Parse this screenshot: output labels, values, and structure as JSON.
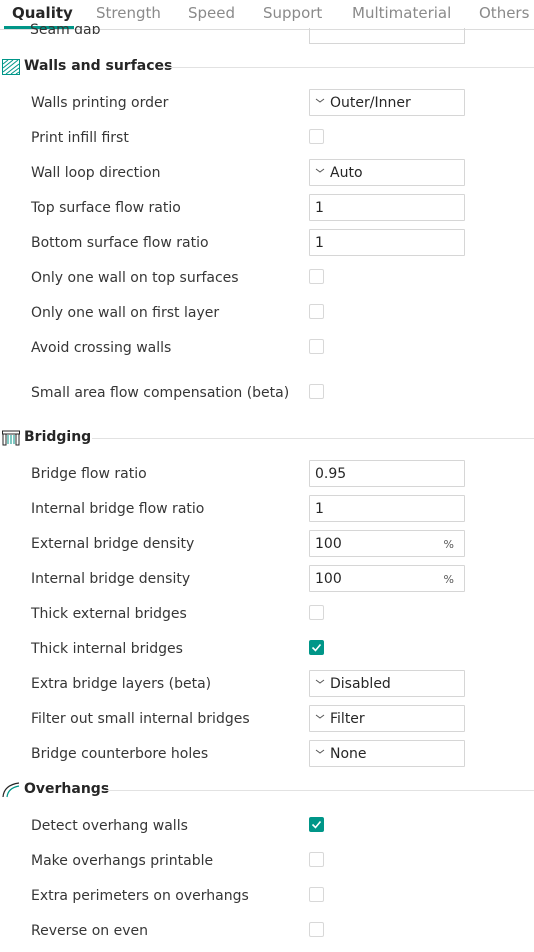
{
  "tabs": [
    {
      "label": "Quality",
      "active": true
    },
    {
      "label": "Strength",
      "active": false
    },
    {
      "label": "Speed",
      "active": false
    },
    {
      "label": "Support",
      "active": false
    },
    {
      "label": "Multimaterial",
      "active": false
    },
    {
      "label": "Others",
      "active": false
    }
  ],
  "partial_row": {
    "label": "Seam gap"
  },
  "sections": {
    "walls": {
      "title": "Walls and surfaces",
      "icon": "walls-surfaces-icon",
      "rows": [
        {
          "label": "Walls printing order",
          "type": "combo",
          "value": "Outer/Inner"
        },
        {
          "label": "Print infill first",
          "type": "checkbox",
          "checked": false
        },
        {
          "label": "Wall loop direction",
          "type": "combo",
          "value": "Auto"
        },
        {
          "label": "Top surface flow ratio",
          "type": "text",
          "value": "1"
        },
        {
          "label": "Bottom surface flow ratio",
          "type": "text",
          "value": "1"
        },
        {
          "label": "Only one wall on top surfaces",
          "type": "checkbox",
          "checked": false
        },
        {
          "label": "Only one wall on first layer",
          "type": "checkbox",
          "checked": false
        },
        {
          "label": "Avoid crossing walls",
          "type": "checkbox",
          "checked": false
        },
        {
          "label": "Small area flow compensation (beta)",
          "type": "checkbox",
          "checked": false
        }
      ]
    },
    "bridging": {
      "title": "Bridging",
      "icon": "bridging-icon",
      "rows": [
        {
          "label": "Bridge flow ratio",
          "type": "text",
          "value": "0.95"
        },
        {
          "label": "Internal bridge flow ratio",
          "type": "text",
          "value": "1"
        },
        {
          "label": "External bridge density",
          "type": "text",
          "value": "100",
          "unit": "%"
        },
        {
          "label": "Internal bridge density",
          "type": "text",
          "value": "100",
          "unit": "%"
        },
        {
          "label": "Thick external bridges",
          "type": "checkbox",
          "checked": false
        },
        {
          "label": "Thick internal bridges",
          "type": "checkbox",
          "checked": true
        },
        {
          "label": "Extra bridge layers (beta)",
          "type": "combo",
          "value": "Disabled"
        },
        {
          "label": "Filter out small internal bridges",
          "type": "combo",
          "value": "Filter"
        },
        {
          "label": "Bridge counterbore holes",
          "type": "combo",
          "value": "None"
        }
      ]
    },
    "overhangs": {
      "title": "Overhangs",
      "icon": "overhangs-icon",
      "rows": [
        {
          "label": "Detect overhang walls",
          "type": "checkbox",
          "checked": true
        },
        {
          "label": "Make overhangs printable",
          "type": "checkbox",
          "checked": false
        },
        {
          "label": "Extra perimeters on overhangs",
          "type": "checkbox",
          "checked": false
        },
        {
          "label": "Reverse on even",
          "type": "checkbox",
          "checked": false
        }
      ]
    }
  },
  "colors": {
    "accent": "#009688",
    "border": "#d6d6d6",
    "text": "#363636"
  }
}
